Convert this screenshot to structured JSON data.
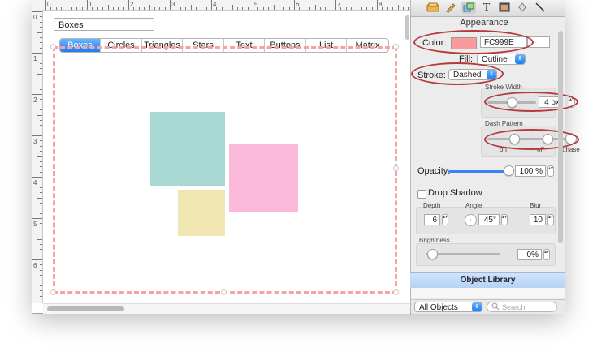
{
  "canvas": {
    "name_field_value": "Boxes",
    "ruler_top": [
      "0",
      "1",
      "2",
      "3",
      "4",
      "5",
      "6",
      "7",
      "8"
    ],
    "ruler_left": [
      "0",
      "1",
      "2",
      "3",
      "4",
      "5",
      "6"
    ],
    "dashed_border_color": "#f6a2a2",
    "tabs": [
      {
        "label": "Boxes",
        "selected": true
      },
      {
        "label": "Circles",
        "selected": false
      },
      {
        "label": "Triangles",
        "selected": false
      },
      {
        "label": "Stars",
        "selected": false
      },
      {
        "label": "Text",
        "selected": false
      },
      {
        "label": "Buttons",
        "selected": false
      },
      {
        "label": "List",
        "selected": false
      },
      {
        "label": "Matrix",
        "selected": false
      }
    ],
    "shapes": [
      {
        "name": "teal-box",
        "color": "#a8d8d2"
      },
      {
        "name": "pink-box",
        "color": "#fbb9da"
      },
      {
        "name": "yellow-box",
        "color": "#efe6b2"
      }
    ]
  },
  "inspector": {
    "toolbar_icons": [
      "layers-icon",
      "pencil-icon",
      "arrange-icon",
      "text-icon",
      "media-icon",
      "link-icon",
      "line-icon"
    ],
    "section_title": "Appearance",
    "color_label": "Color:",
    "color_swatch": "#FC999E",
    "color_hex": "FC999E",
    "fill_label": "Fill:",
    "fill_value": "Outline",
    "stroke_label": "Stroke:",
    "stroke_value": "Dashed",
    "stroke_width_label": "Stroke Width",
    "stroke_width_value": "4 px",
    "dash_pattern_label": "Dash Pattern",
    "dash_on_label": "on",
    "dash_off_label": "off",
    "dash_phase_label": "phase",
    "opacity_label": "Opacity:",
    "opacity_value": "100 %",
    "drop_shadow_label": "Drop Shadow",
    "depth_label": "Depth",
    "depth_value": "6",
    "angle_label": "Angle",
    "angle_value": "45°",
    "blur_label": "Blur",
    "blur_value": "10",
    "brightness_label": "Brightness",
    "brightness_value": "0%",
    "object_library_label": "Object Library",
    "all_objects_value": "All Objects",
    "search_placeholder": "Search",
    "highlight_color": "#b53a3a"
  }
}
